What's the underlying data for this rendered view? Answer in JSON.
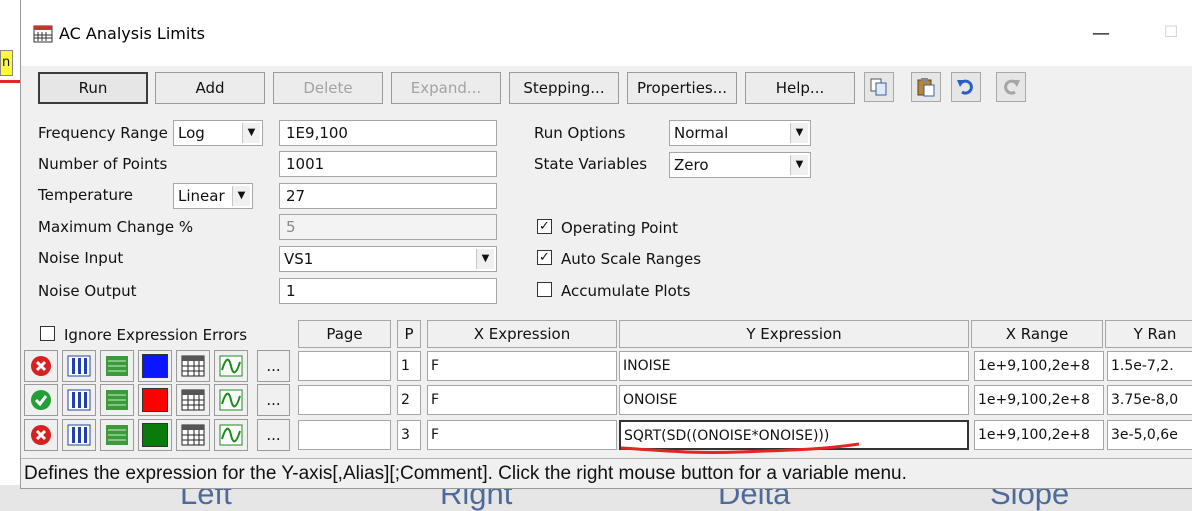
{
  "window": {
    "title": "AC Analysis Limits"
  },
  "toolbar": {
    "run": "Run",
    "add": "Add",
    "delete": "Delete",
    "expand": "Expand...",
    "stepping": "Stepping...",
    "properties": "Properties...",
    "help": "Help..."
  },
  "form": {
    "frequency_range": {
      "label": "Frequency Range",
      "mode": "Log",
      "value": "1E9,100"
    },
    "number_of_points": {
      "label": "Number of Points",
      "value": "1001"
    },
    "temperature": {
      "label": "Temperature",
      "mode": "Linear",
      "value": "27"
    },
    "maximum_change": {
      "label": "Maximum Change %",
      "value": "5"
    },
    "noise_input": {
      "label": "Noise Input",
      "value": "VS1"
    },
    "noise_output": {
      "label": "Noise Output",
      "value": "1"
    },
    "run_options": {
      "label": "Run Options",
      "value": "Normal"
    },
    "state_variables": {
      "label": "State Variables",
      "value": "Zero"
    },
    "operating_point": {
      "label": "Operating Point",
      "checked": true
    },
    "auto_scale_ranges": {
      "label": "Auto Scale Ranges",
      "checked": true
    },
    "accumulate_plots": {
      "label": "Accumulate Plots",
      "checked": false
    },
    "ignore_expression_errors": {
      "label": "Ignore Expression Errors",
      "checked": false
    }
  },
  "grid": {
    "headers": {
      "page": "Page",
      "p": "P",
      "x_expression": "X Expression",
      "y_expression": "Y Expression",
      "x_range": "X Range",
      "y_range": "Y Ran"
    },
    "rows": [
      {
        "enabled": false,
        "color": "#0a16ff",
        "page": "",
        "p": "1",
        "x_expression": "F",
        "y_expression": "INOISE",
        "x_range": "1e+9,100,2e+8",
        "y_range": "1.5e-7,2.",
        "more": "..."
      },
      {
        "enabled": true,
        "color": "#ff0000",
        "page": "",
        "p": "2",
        "x_expression": "F",
        "y_expression": "ONOISE",
        "x_range": "1e+9,100,2e+8",
        "y_range": "3.75e-8,0",
        "more": "..."
      },
      {
        "enabled": false,
        "color": "#0a7a0a",
        "page": "",
        "p": "3",
        "x_expression": "F",
        "y_expression": "SQRT(SD((ONOISE*ONOISE)))",
        "x_range": "1e+9,100,2e+8",
        "y_range": "3e-5,0,6e",
        "more": "..."
      }
    ]
  },
  "status_bar": "Defines the expression for the Y-axis[,Alias][;Comment]. Click the right mouse button for a variable menu.",
  "background": {
    "tag": "n",
    "labels": [
      "Left",
      "Right",
      "Delta",
      "Slope"
    ]
  },
  "colors": {
    "accent_red": "#e32525",
    "check_green": "#22a035",
    "x_red": "#d92020"
  }
}
